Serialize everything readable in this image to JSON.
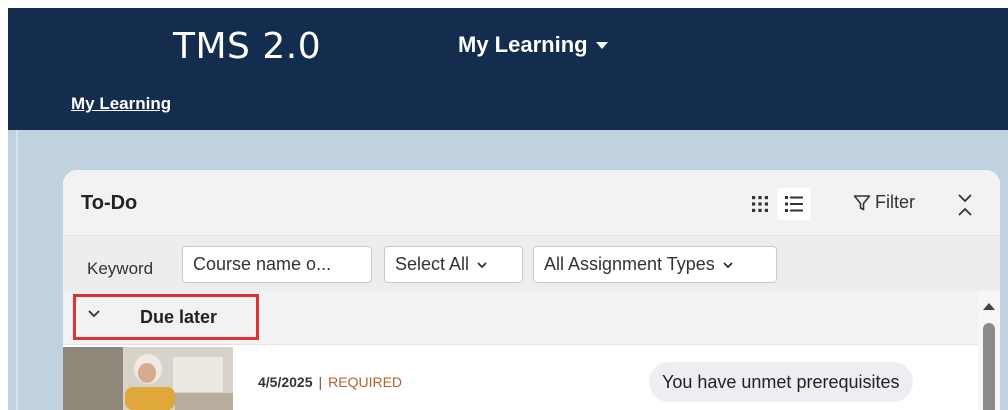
{
  "header": {
    "brand": "TMS 2.0",
    "nav_menu_label": "My Learning",
    "breadcrumb": "My Learning"
  },
  "card": {
    "title": "To-Do",
    "filter_label": "Filter"
  },
  "filters": {
    "keyword_label": "Keyword",
    "keyword_placeholder": "Course name o...",
    "status_select": "Select All",
    "type_select": "All Assignment Types"
  },
  "group": {
    "label": "Due later"
  },
  "items": [
    {
      "date": "4/5/2025",
      "separator": "|",
      "tag": "REQUIRED",
      "status": "You have unmet prerequisites"
    }
  ],
  "colors": {
    "header_bg": "#142c4e",
    "content_bg": "#bfd2dd",
    "required_tag": "#b2632a",
    "highlight": "#e03030"
  }
}
